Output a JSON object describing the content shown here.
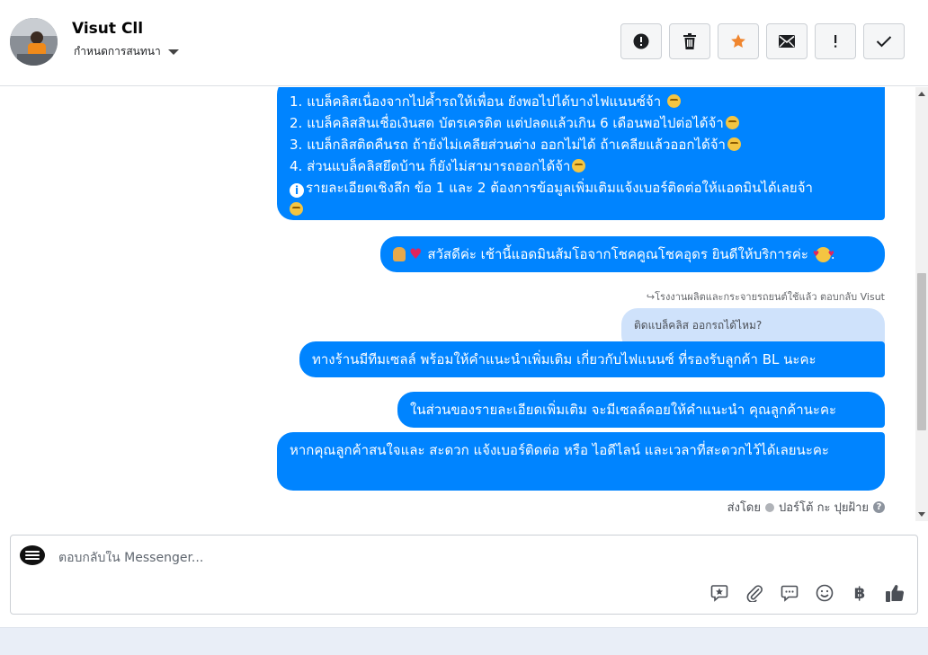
{
  "header": {
    "contact_name": "Visut Cll",
    "assign_label": "กำหนดการสนทนา"
  },
  "actions": [
    {
      "name": "report",
      "icon": "alert-circle-icon"
    },
    {
      "name": "delete",
      "icon": "trash-icon"
    },
    {
      "name": "star",
      "icon": "star-icon",
      "color": "#f0862f"
    },
    {
      "name": "mark-unread",
      "icon": "envelope-icon"
    },
    {
      "name": "important",
      "icon": "exclamation-icon"
    },
    {
      "name": "done",
      "icon": "checkmark-icon"
    }
  ],
  "messages": {
    "m1_lines": [
      "1. แบล็คลิสเนื่องจากไปค้ำรถให้เพื่อน ยังพอไปได้บางไฟแนนซ์จ้า",
      "2. แบล็คลิสสินเชื่อเงินสด บัตรเครดิต แต่ปลดแล้วเกิน 6 เดือนพอไปต่อได้จ้า",
      "3. แบล็กลิสติดคืนรถ ถ้ายังไม่เคลียส่วนต่าง ออกไม่ได้ ถ้าเคลียแล้วออกได้จ้า",
      "4. ส่วนแบล็คลิสยึดบ้าน ก็ยังไม่สามารถออกได้จ้า",
      "รายละเอียดเชิงลึก ข้อ 1 และ 2 ต้องการข้อมูลเพิ่มเติมแจ้งเบอร์ติดต่อให้แอดมินได้เลยจ้า"
    ],
    "m2": "สวัสดีค่ะ เช้านี้แอดมินส้มโอจากโชคคูณโชคอุดร ยินดีให้บริการค่ะ",
    "m2_end": ".",
    "reply_hint": "โรงงานผลิตและกระจายรถยนต์ใช้แล้ว ตอบกลับ Visut",
    "quoted": "ติดแบล็คลิส ออกรถได้ไหม?",
    "m3": "ทางร้านมีทีมเซลล์ พร้อมให้คำแนะนำเพิ่มเติม เกี่ยวกับไฟแนนซ์ ที่รองรับลูกค้า BL นะคะ",
    "m4": "ในส่วนของรายละเอียดเพิ่มเติม จะมีเซลล์คอยให้คำแนะนำ คุณลูกค้านะคะ",
    "m5": "หากคุณลูกค้าสนใจและ สะดวก แจ้งเบอร์ติดต่อ หรือ ไอดีไลน์ และเวลาที่สะดวกไว้ได้เลยนะคะ",
    "sent_by_label": "ส่งโดย",
    "sender_name": "ปอร์โต้ กะ ปุยฝ้าย"
  },
  "composer": {
    "placeholder": "ตอบกลับใน Messenger...",
    "tools": [
      "saved-reply-icon",
      "attachment-icon",
      "chat-bubble-icon",
      "emoji-icon",
      "baht-icon",
      "thumbs-up-icon"
    ],
    "baht_symbol": "฿"
  }
}
